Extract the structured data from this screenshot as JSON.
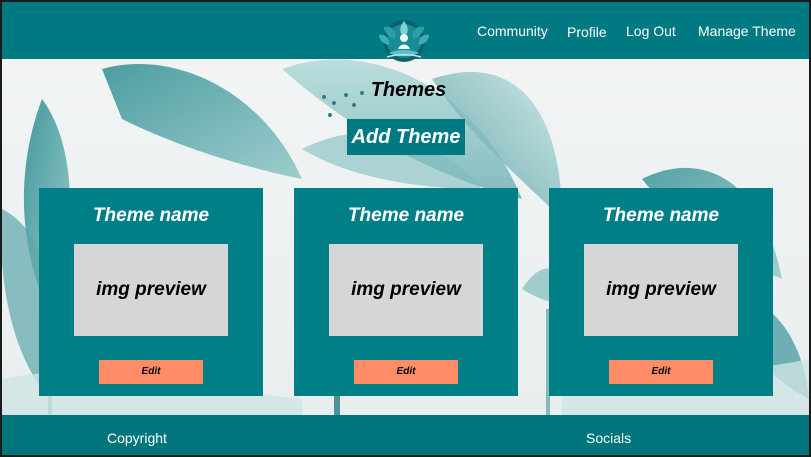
{
  "header": {
    "nav": {
      "community": "Community",
      "profile": "Profile",
      "logout": "Log Out",
      "manage_theme": "Manage Theme"
    }
  },
  "main": {
    "title": "Themes",
    "add_theme_label": "Add Theme",
    "cards": [
      {
        "name": "Theme name",
        "preview_text": "img preview",
        "edit_label": "Edit"
      },
      {
        "name": "Theme name",
        "preview_text": "img preview",
        "edit_label": "Edit"
      },
      {
        "name": "Theme name",
        "preview_text": "img preview",
        "edit_label": "Edit"
      }
    ]
  },
  "footer": {
    "copyright": "Copyright",
    "socials": "Socials"
  },
  "colors": {
    "primary": "#007a82",
    "card": "#007f87",
    "edit_button": "#ff8c66",
    "preview_bg": "#d6d6d6"
  },
  "icons": {
    "logo": "lotus-logo-icon"
  }
}
